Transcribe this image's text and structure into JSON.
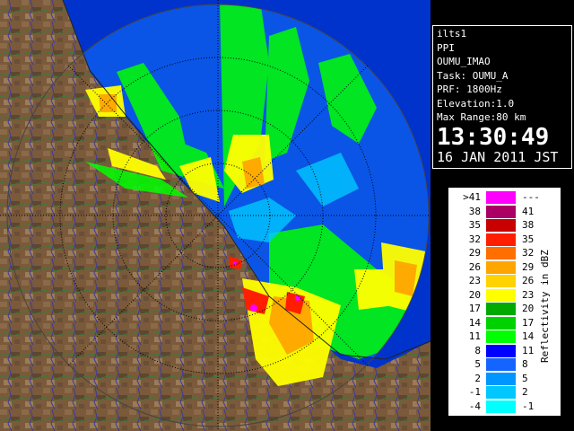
{
  "info_panel": {
    "station": "ilts1",
    "scan_type": "PPI",
    "product": "OUMU_IMAO",
    "task": "Task: OUMU_A",
    "prf": "PRF: 1800Hz",
    "elevation": "Elevation:1.0",
    "max_range": "Max Range:80 km",
    "time": "13:30:49",
    "date": "16 JAN 2011 JST"
  },
  "legend": {
    "title": "Reflectivity in dBZ",
    "rows": [
      {
        "low": ">41",
        "high": "---",
        "color": "#ff00ff"
      },
      {
        "low": "38",
        "high": "41",
        "color": "#aa0066"
      },
      {
        "low": "35",
        "high": "38",
        "color": "#c80000"
      },
      {
        "low": "32",
        "high": "35",
        "color": "#ff1e00"
      },
      {
        "low": "29",
        "high": "32",
        "color": "#ff6e00"
      },
      {
        "low": "26",
        "high": "29",
        "color": "#ffa500"
      },
      {
        "low": "23",
        "high": "26",
        "color": "#ffd200"
      },
      {
        "low": "20",
        "high": "23",
        "color": "#ffff00"
      },
      {
        "low": "17",
        "high": "20",
        "color": "#00aa00"
      },
      {
        "low": "14",
        "high": "17",
        "color": "#00d200"
      },
      {
        "low": "11",
        "high": "14",
        "color": "#00ff00"
      },
      {
        "low": "8",
        "high": "11",
        "color": "#0000ff"
      },
      {
        "low": "5",
        "high": "8",
        "color": "#1464ff"
      },
      {
        "low": "2",
        "high": "5",
        "color": "#0096ff"
      },
      {
        "low": "-1",
        "high": "2",
        "color": "#00c8ff"
      },
      {
        "low": "-4",
        "high": "-1",
        "color": "#00ffff"
      }
    ]
  },
  "colors": {
    "sea": "#0a55e6",
    "outside_sea": "#0033cc",
    "land": "#7a5a3a",
    "rings": "#000000"
  }
}
